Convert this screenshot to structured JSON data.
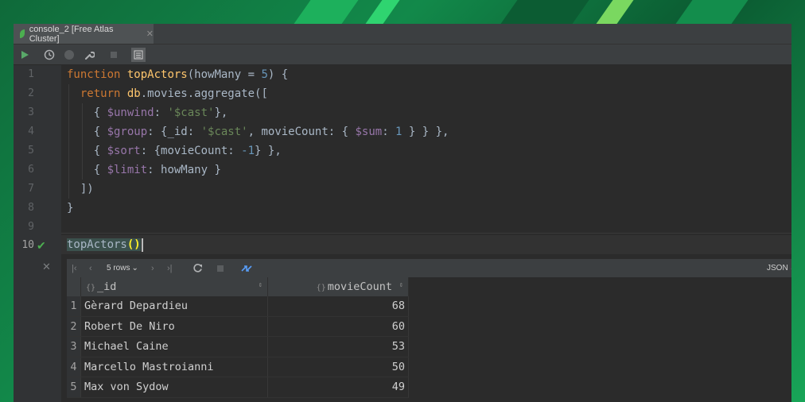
{
  "tab": {
    "title": "console_2 [Free Atlas Cluster]"
  },
  "code": {
    "line_numbers": [
      "1",
      "2",
      "3",
      "4",
      "5",
      "6",
      "7",
      "8",
      "9",
      "10"
    ],
    "l1": {
      "kw": "function",
      "name": "topActors",
      "p": "(howMany = ",
      "num": "5",
      "end": ") {"
    },
    "l2": {
      "kw": "return",
      "db": "db",
      "rest": ".movies.aggregate(["
    },
    "l3": {
      "a": "{ ",
      "op": "$unwind",
      "b": ": ",
      "str": "'$cast'",
      "c": "},"
    },
    "l4": {
      "a": "{ ",
      "op1": "$group",
      "b": ": {_id: ",
      "str": "'$cast'",
      "c": ", movieCount: { ",
      "op2": "$sum",
      "d": ": ",
      "num": "1",
      "e": " } } },"
    },
    "l5": {
      "a": "{ ",
      "op": "$sort",
      "b": ": {movieCount: ",
      "num": "-1",
      "c": "} },"
    },
    "l6": {
      "a": "{ ",
      "op": "$limit",
      "b": ": howMany }"
    },
    "l7": "])",
    "l8": "}",
    "l10": {
      "name": "topActors",
      "parens": "()"
    }
  },
  "results": {
    "rows_label": "5 rows",
    "format_label": "JSON",
    "columns": [
      "_id",
      "movieCount"
    ],
    "rows": [
      [
        "1",
        "Gèrard Depardieu",
        "68"
      ],
      [
        "2",
        "Robert De Niro",
        "60"
      ],
      [
        "3",
        "Michael Caine",
        "53"
      ],
      [
        "4",
        "Marcello Mastroianni",
        "50"
      ],
      [
        "5",
        "Max von Sydow",
        "49"
      ]
    ]
  },
  "colors": {
    "accent_green": "#4caf50",
    "keyword": "#cc7832",
    "string": "#6a8759",
    "number": "#6897bb",
    "operator": "#9876aa"
  }
}
